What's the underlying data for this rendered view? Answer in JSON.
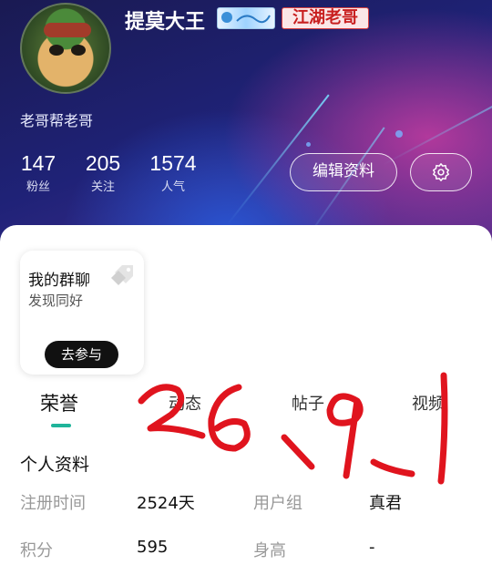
{
  "profile": {
    "username": "提莫大王",
    "badge_blue": "",
    "badge_red": "江湖老哥",
    "bio": "老哥帮老哥"
  },
  "stats": [
    {
      "value": "147",
      "label": "粉丝"
    },
    {
      "value": "205",
      "label": "关注"
    },
    {
      "value": "1574",
      "label": "人气"
    }
  ],
  "actions": {
    "edit_label": "编辑资料"
  },
  "group_card": {
    "title": "我的群聊",
    "subtitle": "发现同好",
    "join_label": "去参与"
  },
  "tabs": [
    {
      "label": "荣誉",
      "active": true
    },
    {
      "label": "动态"
    },
    {
      "label": "帖子"
    },
    {
      "label": "视频"
    }
  ],
  "profile_section": {
    "title": "个人资料",
    "rows": [
      {
        "label1": "注册时间",
        "value1": "2524天",
        "label2": "用户组",
        "value2": "真君"
      },
      {
        "label1": "积分",
        "value1": "595",
        "label2": "身高",
        "value2": "-"
      }
    ]
  },
  "colors": {
    "accent": "#1fb49a",
    "handwriting": "#e0141e",
    "badge_red": "#c81e1e"
  }
}
